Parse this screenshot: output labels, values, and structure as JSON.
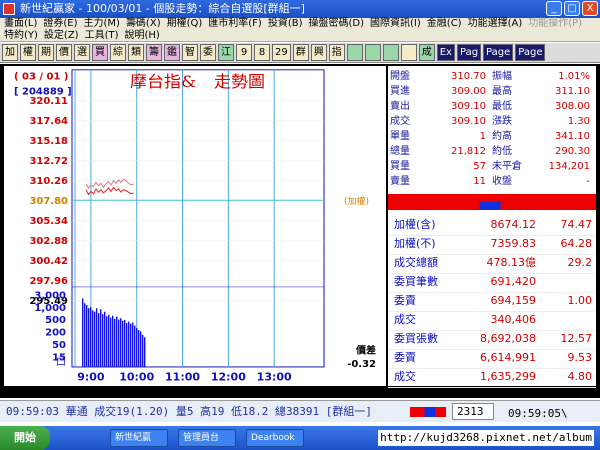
{
  "window": {
    "title": "新世紀贏家 - 100/03/01 - 個股走勢：綜合自選股[群組一]",
    "buttons": [
      "_",
      "□",
      "X"
    ]
  },
  "menu": {
    "row1": [
      "畫面(L)",
      "證券(E)",
      "主力(M)",
      "籌碼(X)",
      "期權(Q)",
      "匯市利率(F)",
      "投資(B)",
      "操盤密碼(D)",
      "國際資訊(I)",
      "金融(C)",
      "功能選擇(A)"
    ],
    "row1_disabled": "功能操作(P)",
    "row2": [
      "特約(Y)",
      "設定(Z)",
      "工具(T)",
      "說明(H)"
    ]
  },
  "toolbar": {
    "buttons": [
      "加",
      "權",
      "期",
      "價",
      "選",
      "買",
      "綜",
      "類",
      "籌",
      "鑑",
      "智",
      "委",
      "江",
      "9",
      "8",
      "29",
      "群",
      "興",
      "指",
      "",
      "",
      "",
      "",
      "成",
      "Ex",
      "Pag",
      "Page",
      "Page"
    ]
  },
  "chart": {
    "date_label": "( 03 / 01 )",
    "volume_label": "[ 204889 ]",
    "title_a": "摩台指&",
    "title_b": "走勢圖",
    "ref_label": "(加權)",
    "diff_label": "價差",
    "diff_value": "-0.32",
    "vol_corner": "口",
    "colors": {
      "axis": "#1010c0",
      "grid": "#4aa8e0",
      "line1": "#e07090",
      "line2": "#e02020",
      "vol": "#1010e0",
      "ref": "#40c0d0"
    }
  },
  "chart_data": {
    "type": "line",
    "title": "摩台指& 走勢圖",
    "y_ticks": [
      "320.11",
      "317.64",
      "315.18",
      "312.72",
      "310.26",
      "307.80",
      "305.34",
      "302.88",
      "300.42",
      "297.96",
      "295.49"
    ],
    "ylim": [
      295.49,
      320.11
    ],
    "reference": 307.8,
    "x_ticks": [
      "9:00",
      "10:00",
      "11:00",
      "12:00",
      "13:00"
    ],
    "volume_ticks": [
      "3,000",
      "1,000",
      "500",
      "200",
      "50",
      "15"
    ],
    "series": [
      {
        "values": [
          309.8,
          309.3,
          309.7,
          309.5,
          310.0,
          309.6,
          309.9,
          309.4,
          309.8,
          310.1,
          309.7,
          310.2,
          309.9,
          310.3,
          310.0,
          310.4,
          310.2,
          309.9,
          309.7,
          309.8
        ]
      },
      {
        "values": [
          309.1,
          308.5,
          308.9,
          308.6,
          309.2,
          308.8,
          309.1,
          308.7,
          309.0,
          309.3,
          308.9,
          309.4,
          309.0,
          309.2,
          308.8,
          309.1,
          309.0,
          308.8,
          308.6,
          308.7
        ]
      }
    ],
    "volume": [
      2800,
      1600,
      1300,
      900,
      1000,
      700,
      600,
      900,
      500,
      800,
      450,
      600,
      350,
      420,
      300,
      380,
      260,
      330,
      240,
      280,
      210,
      230,
      160,
      190,
      150,
      170,
      120,
      90,
      70,
      60,
      40,
      30
    ]
  },
  "quote": {
    "rows": [
      {
        "l1": "開盤",
        "v1": "310.70",
        "l2": "振幅",
        "v2": "1.01%",
        "c1": "red",
        "c2": "red"
      },
      {
        "l1": "買進",
        "v1": "309.00",
        "l2": "最高",
        "v2": "311.10",
        "c1": "red",
        "c2": "red"
      },
      {
        "l1": "賣出",
        "v1": "309.10",
        "l2": "最低",
        "v2": "308.00",
        "c1": "red",
        "c2": "red"
      },
      {
        "l1": "成交",
        "v1": "309.10",
        "l2": "漲跌",
        "v2": "1.30",
        "c1": "red",
        "c2": "red"
      },
      {
        "l1": "單量",
        "v1": "1",
        "l2": "約高",
        "v2": "341.10",
        "c1": "red",
        "c2": "red"
      },
      {
        "l1": "總量",
        "v1": "21,812",
        "l2": "約低",
        "v2": "290.30",
        "c1": "red",
        "c2": "red"
      },
      {
        "l1": "買量",
        "v1": "57",
        "l2": "未平倉",
        "v2": "134,201",
        "c1": "red",
        "c2": "red"
      },
      {
        "l1": "賣量",
        "v1": "11",
        "l2": "收盤",
        "v2": "-",
        "c1": "red",
        "c2": "red"
      }
    ],
    "indices": [
      {
        "label": "加權(含)",
        "value": "8674.12",
        "change": "74.47"
      },
      {
        "label": "加權(不)",
        "value": "7359.83",
        "change": "64.28"
      },
      {
        "label": "成交總額",
        "value": "478.13億",
        "change": "29.2"
      },
      {
        "label": "委買筆數",
        "value": "691,420",
        "change": ""
      },
      {
        "label": "委賣",
        "value": "694,159",
        "change": "1.00"
      },
      {
        "label": "成交",
        "value": "340,406",
        "change": ""
      },
      {
        "label": "委買張數",
        "value": "8,692,038",
        "change": "12.57"
      },
      {
        "label": "委賣",
        "value": "6,614,991",
        "change": "9.53"
      },
      {
        "label": "成交",
        "value": "1,635,299",
        "change": "4.80"
      }
    ]
  },
  "status": {
    "text": "09:59:03 華通 成交19(1.20) 量5 高19 低18.2 總38391 [群組一]",
    "code": "2313",
    "clock": "09:59:05\\"
  },
  "taskbar": {
    "start": "開始",
    "items": [
      "新世紀贏",
      "管理員台",
      "Dearbook"
    ],
    "watermark": "http://kujd3268.pixnet.net/album"
  }
}
